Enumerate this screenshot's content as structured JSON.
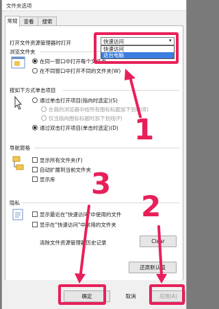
{
  "window": {
    "title": "文件夹选项"
  },
  "tabs": [
    "常规",
    "查看",
    "搜索"
  ],
  "open_explorer": {
    "label": "打开文件资源管理器时打开",
    "selected": "快速访问",
    "options": [
      "快速访问",
      "这台电脑"
    ]
  },
  "browse": {
    "header": "浏览文件夹",
    "opt_same": "在同一窗口中打开每个文件夹",
    "opt_new": "在不同窗口中打开不同的文件夹(W)"
  },
  "click": {
    "header": "按如下方式单击项目",
    "opt_single": "通过单击打开项目(指向时选定)(S)",
    "sub1": "在我的浏览器中给所有图标标题加下划线(B)",
    "sub2": "仅当指向图标标题时加下划线(P)",
    "opt_double": "通过双击打开项目(单击时选定)(D)"
  },
  "nav": {
    "header": "导航窗格",
    "show_all": "显示所有文件夹(F)",
    "auto_expand": "自动扩展到当前文件夹",
    "show_libs": "显示库"
  },
  "privacy": {
    "header": "隐私",
    "recent_files": "显示最近在\"快速访问\"中使用的文件",
    "frequent_folders": "显示在\"快速访问\"中常用的文件夹",
    "clear_label": "清除文件资源管理器历史记录",
    "clear_button": "Clear"
  },
  "restore_button": "还原默认值",
  "footer": {
    "ok": "确定",
    "cancel": "取消",
    "apply": "应用(A)"
  },
  "annotations": [
    "1",
    "2",
    "3"
  ]
}
